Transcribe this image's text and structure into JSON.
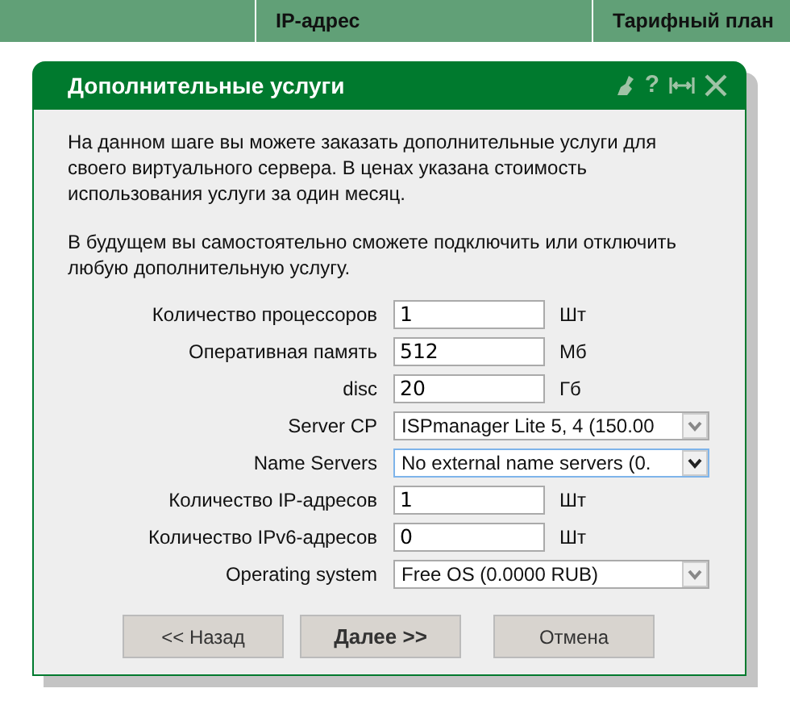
{
  "table": {
    "columns": [
      "IP-адрес",
      "Тарифный план"
    ]
  },
  "dialog": {
    "title": "Дополнительные услуги",
    "help": "?",
    "paragraphs": [
      "На данном шаге вы можете заказать дополнительные услуги для своего виртуального сервера. В ценах указана стоимость использования услуги за один месяц.",
      "В будущем вы самостоятельно сможете подключить или отключить любую дополнительную услугу."
    ],
    "fields": [
      {
        "kind": "input",
        "label": "Количество процессоров",
        "value": "1",
        "unit": "Шт"
      },
      {
        "kind": "input",
        "label": "Оперативная память",
        "value": "512",
        "unit": "Мб"
      },
      {
        "kind": "input",
        "label": "disc",
        "value": "20",
        "unit": "Гб"
      },
      {
        "kind": "select",
        "label": "Server CP",
        "value": "ISPmanager Lite 5, 4 (150.00",
        "focused": false
      },
      {
        "kind": "select",
        "label": "Name Servers",
        "value": "No external name servers (0.",
        "focused": true
      },
      {
        "kind": "input",
        "label": "Количество IP-адресов",
        "value": "1",
        "unit": "Шт"
      },
      {
        "kind": "input",
        "label": "Количество IPv6-адресов",
        "value": "0",
        "unit": "Шт"
      },
      {
        "kind": "select",
        "label": "Operating system",
        "value": "Free OS (0.0000 RUB)",
        "focused": false
      }
    ],
    "buttons": [
      {
        "label": "<< Назад",
        "default": false
      },
      {
        "label": "Далее >>",
        "default": true
      },
      {
        "label": "Отмена",
        "default": false
      }
    ]
  }
}
